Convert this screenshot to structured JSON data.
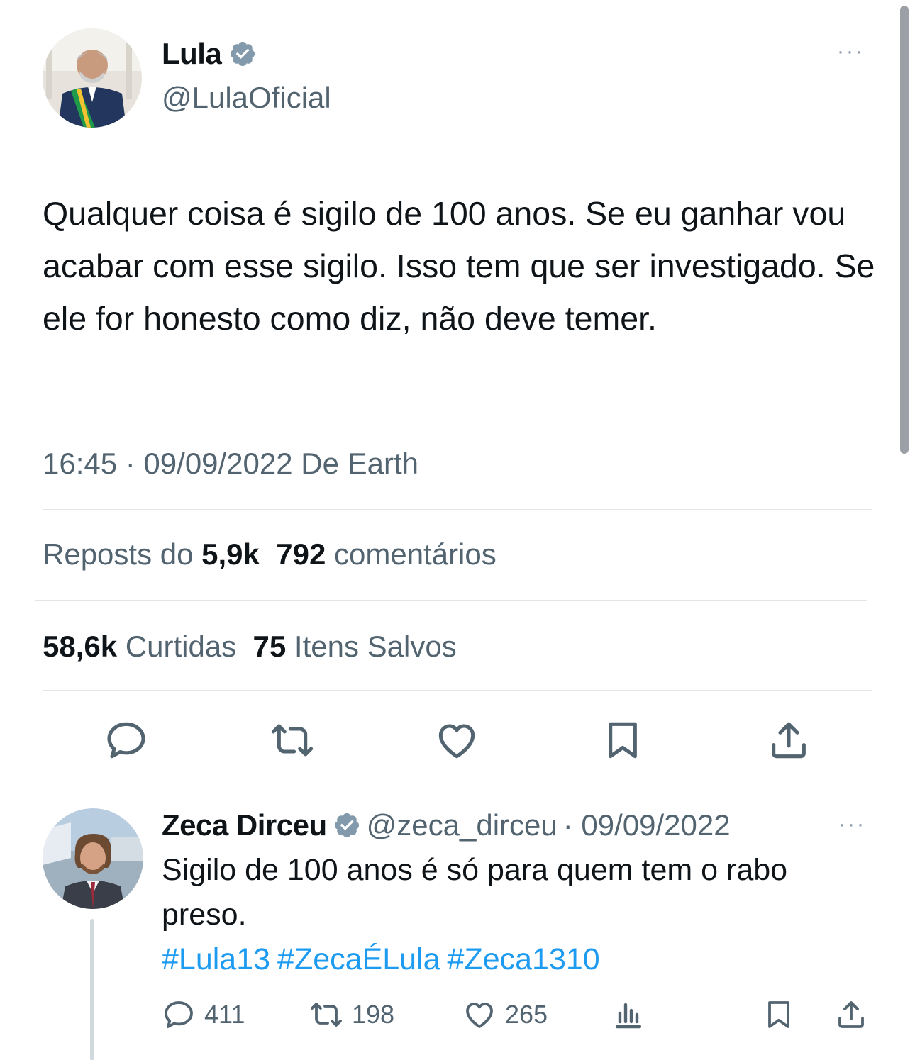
{
  "main_tweet": {
    "author_name": "Lula",
    "author_handle": "@LulaOficial",
    "text": "Qualquer coisa é sigilo de 100 anos. Se eu ganhar vou acabar com esse sigilo. Isso tem que ser investigado. Se ele for honesto como diz, não deve temer.",
    "timestamp": "16:45 · 09/09/2022 De Earth",
    "reposts_label": "Reposts do",
    "reposts_count": "5,9k",
    "comments_count": "792",
    "comments_label": "comentários",
    "likes_count": "58,6k",
    "likes_label": "Curtidas",
    "saves_count": "75",
    "saves_label": "Itens Salvos",
    "actions": [
      "reply-icon",
      "repost-icon",
      "like-icon",
      "bookmark-icon",
      "share-icon"
    ]
  },
  "reply": {
    "author_name": "Zeca Dirceu",
    "author_handle": "@zeca_dirceu",
    "date": "· 09/09/2022",
    "text": "Sigilo de 100 anos é só para quem tem o rabo preso.",
    "hashtags": [
      "#Lula13",
      "#ZecaÉLula",
      "#Zeca1310"
    ],
    "reply_count": "411",
    "repost_count": "198",
    "like_count": "265"
  },
  "more_icon": "···",
  "colors": {
    "text": "#0f1419",
    "secondary": "#536471",
    "accent": "#1d9bf0",
    "verified": "#829aab",
    "divider": "#e1e5e8"
  }
}
